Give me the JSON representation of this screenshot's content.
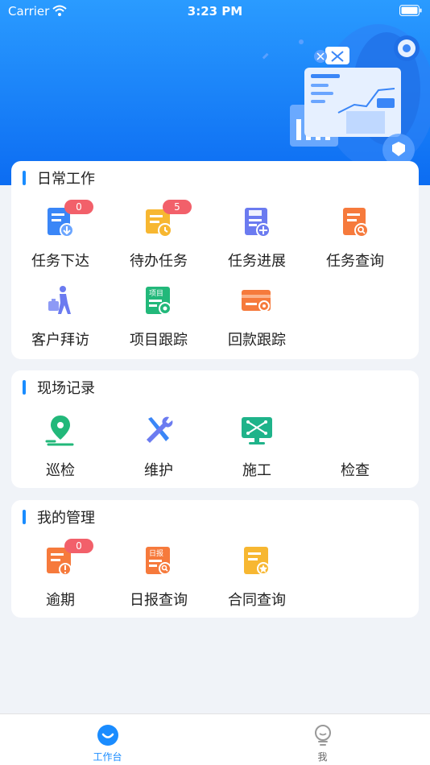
{
  "status": {
    "carrier": "Carrier",
    "time": "3:23 PM"
  },
  "sections": [
    {
      "title": "日常工作",
      "items": [
        {
          "label": "任务下达",
          "icon": "task-assign-icon",
          "badge": "0"
        },
        {
          "label": "待办任务",
          "icon": "todo-task-icon",
          "badge": "5"
        },
        {
          "label": "任务进展",
          "icon": "task-progress-icon",
          "badge": ""
        },
        {
          "label": "任务查询",
          "icon": "task-query-icon",
          "badge": ""
        },
        {
          "label": "客户拜访",
          "icon": "customer-visit-icon",
          "badge": ""
        },
        {
          "label": "项目跟踪",
          "icon": "project-tracking-icon",
          "badge": "",
          "icon_text": "项目"
        },
        {
          "label": "回款跟踪",
          "icon": "payment-tracking-icon",
          "badge": ""
        }
      ]
    },
    {
      "title": "现场记录",
      "items": [
        {
          "label": "巡检",
          "icon": "location-pin-icon"
        },
        {
          "label": "维护",
          "icon": "tools-icon"
        },
        {
          "label": "施工",
          "icon": "construction-monitor-icon"
        },
        {
          "label": "检查",
          "icon": ""
        }
      ]
    },
    {
      "title": "我的管理",
      "items": [
        {
          "label": "逾期",
          "icon": "overdue-icon",
          "badge": "0"
        },
        {
          "label": "日报查询",
          "icon": "daily-report-icon",
          "badge": "",
          "icon_text": "日报"
        },
        {
          "label": "合同查询",
          "icon": "contract-query-icon",
          "badge": ""
        }
      ]
    }
  ],
  "tabbar": [
    {
      "label": "工作台",
      "icon": "workbench-icon",
      "active": true
    },
    {
      "label": "我",
      "icon": "profile-icon",
      "active": false
    }
  ],
  "colors": {
    "accent": "#1a8cff",
    "badge": "#f2606a"
  }
}
